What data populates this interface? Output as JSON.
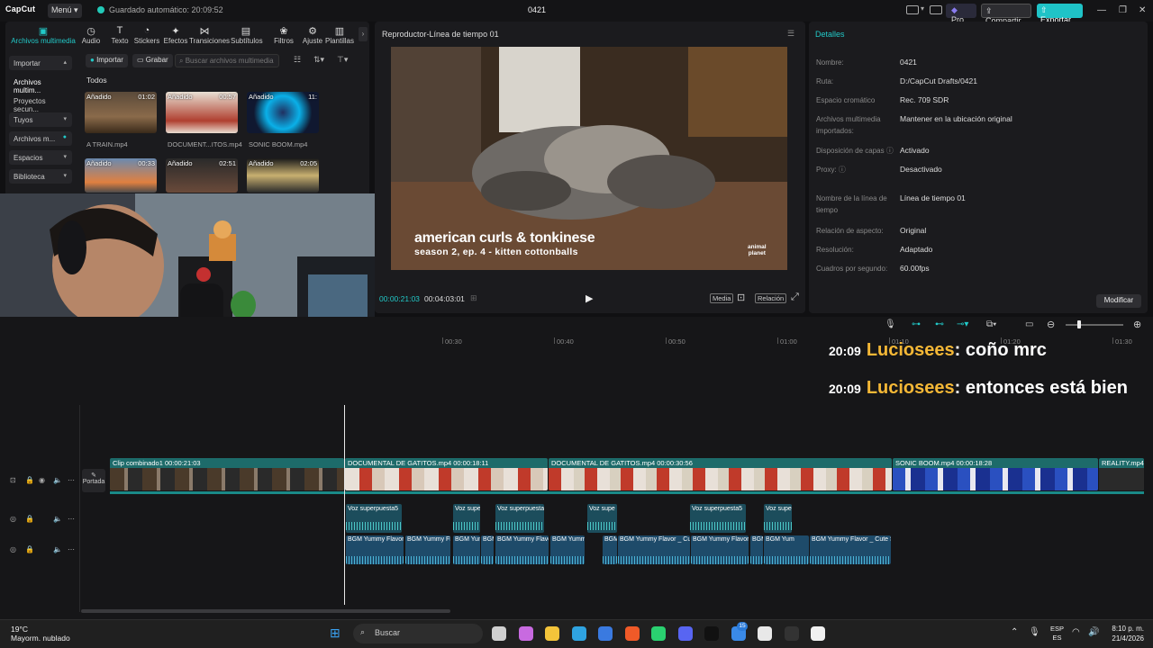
{
  "titlebar": {
    "logo": "CapCut",
    "menu_label": "Menú",
    "autosave": "Guardado automático: 20:09:52",
    "project_name": "0421",
    "pro_label": "Pro",
    "share_label": "Compartir",
    "export_label": "Exportar"
  },
  "tools": [
    {
      "label": "Archivos multimedia",
      "icon": "media-icon",
      "glyph": "▣"
    },
    {
      "label": "Audio",
      "icon": "audio-icon",
      "glyph": "◷"
    },
    {
      "label": "Texto",
      "icon": "text-icon",
      "glyph": "T"
    },
    {
      "label": "Stickers",
      "icon": "sticker-icon",
      "glyph": "◔"
    },
    {
      "label": "Efectos",
      "icon": "effects-icon",
      "glyph": "✦"
    },
    {
      "label": "Transiciones",
      "icon": "transitions-icon",
      "glyph": "⋈"
    },
    {
      "label": "Subtítulos",
      "icon": "subtitles-icon",
      "glyph": "▤"
    },
    {
      "label": "Filtros",
      "icon": "filters-icon",
      "glyph": "❀"
    },
    {
      "label": "Ajuste",
      "icon": "adjust-icon",
      "glyph": "⚙"
    },
    {
      "label": "Plantillas",
      "icon": "templates-icon",
      "glyph": "▥"
    }
  ],
  "nav": [
    {
      "label": "Importar",
      "chev": "▴"
    },
    {
      "label": "Archivos multim...",
      "chev": ""
    },
    {
      "label": "Proyectos secun...",
      "chev": ""
    },
    {
      "label": "Tuyos",
      "chev": "▾"
    },
    {
      "label": "Archivos m...",
      "chev": "●"
    },
    {
      "label": "Espacios",
      "chev": "▾"
    },
    {
      "label": "Biblioteca",
      "chev": "▾"
    }
  ],
  "media": {
    "import_label": "Importar",
    "record_label": "Grabar",
    "search_placeholder": "Buscar archivos multimedia",
    "section": "Todos",
    "items": [
      {
        "badge": "Añadido",
        "duration": "01:02",
        "name": "A TRAIN.mp4"
      },
      {
        "badge": "Añadido",
        "duration": "00:57",
        "name": "DOCUMENT...ITOS.mp4"
      },
      {
        "badge": "Añadido",
        "duration": "11:",
        "name": "SONIC BOOM.mp4"
      },
      {
        "badge": "Añadido",
        "duration": "00:33",
        "name": ""
      },
      {
        "badge": "Añadido",
        "duration": "02:51",
        "name": ""
      },
      {
        "badge": "Añadido",
        "duration": "02:05",
        "name": ""
      }
    ]
  },
  "player": {
    "title": "Reproductor-Línea de tiempo 01",
    "caption_line1": "american curls & tonkinese",
    "caption_line2": "season 2, ep. 4 - kitten cottonballs",
    "logo_line1": "animal",
    "logo_line2": "planet",
    "current_time": "00:00:21:03",
    "total_time": "00:04:03:01",
    "media_label": "Media",
    "ratio_label": "Relación"
  },
  "details": {
    "title": "Detalles",
    "rows": [
      {
        "key": "Nombre:",
        "value": "0421"
      },
      {
        "key": "Ruta:",
        "value": "D:/CapCut Drafts/0421"
      },
      {
        "key": "Espacio cromático",
        "value": "Rec. 709 SDR"
      },
      {
        "key": "Archivos multimedia importados:",
        "value": "Mantener en la ubicación original"
      },
      {
        "key": "Disposición de capas ⓘ",
        "value": "Activado"
      },
      {
        "key": "Proxy: ⓘ",
        "value": "Desactivado"
      },
      {
        "key": "Nombre de la línea de tiempo",
        "value": "Línea de tiempo 01"
      },
      {
        "key": "Relación de aspecto:",
        "value": "Original"
      },
      {
        "key": "Resolución:",
        "value": "Adaptado"
      },
      {
        "key": "Cuadros por segundo:",
        "value": "60.00fps"
      }
    ],
    "modify_label": "Modificar"
  },
  "ruler": [
    "00:30",
    "00:40",
    "00:50",
    "01:00",
    "01:10",
    "01:20",
    "01:30"
  ],
  "chat": [
    {
      "time": "20:09",
      "user": "Luciosees",
      "message": ": coño mrc"
    },
    {
      "time": "20:09",
      "user": "Luciosees",
      "message": ": entonces está bien"
    }
  ],
  "track": {
    "cover_label": "Portada"
  },
  "clips": [
    {
      "label": "Clip combinado1   00:00:21:03"
    },
    {
      "label": "DOCUMENTAL DE GATITOS.mp4   00:00:18:11"
    },
    {
      "label": "DOCUMENTAL DE GATITOS.mp4   00:00:30:56"
    },
    {
      "label": "SONIC BOOM.mp4   00:00:18:28"
    },
    {
      "label": "REALITY.mp4"
    }
  ],
  "voice_clips": [
    "Voz superpuesta5",
    "Voz supe",
    "Voz superpuesta5",
    "Voz supe",
    "Voz superpuesta5",
    "Voz supe"
  ],
  "bgm_clips": [
    "BGM Yummy Flavor_",
    "BGM Yummy Fla",
    "BGM Yum",
    "BGM",
    "BGM Yummy Flavo",
    "BGM Yummy",
    "BGM Yum",
    "BGM Yummy Flavor _ Cut",
    "BGM Yummy Flavor_",
    "BGM",
    "BGM Yum",
    "BGM Yummy Flavor _ Cute  Sweet"
  ],
  "taskbar": {
    "temp": "19°C",
    "weather": "Mayorm. nublado",
    "search": "Buscar",
    "lang1": "ESP",
    "lang2": "ES",
    "time": "8:10 p. m.",
    "date": "21/4/2026",
    "badge": "15"
  },
  "colors": {
    "accent": "#22c9c8",
    "export": "#1fc3c7",
    "chat_user": "#f5b836"
  }
}
